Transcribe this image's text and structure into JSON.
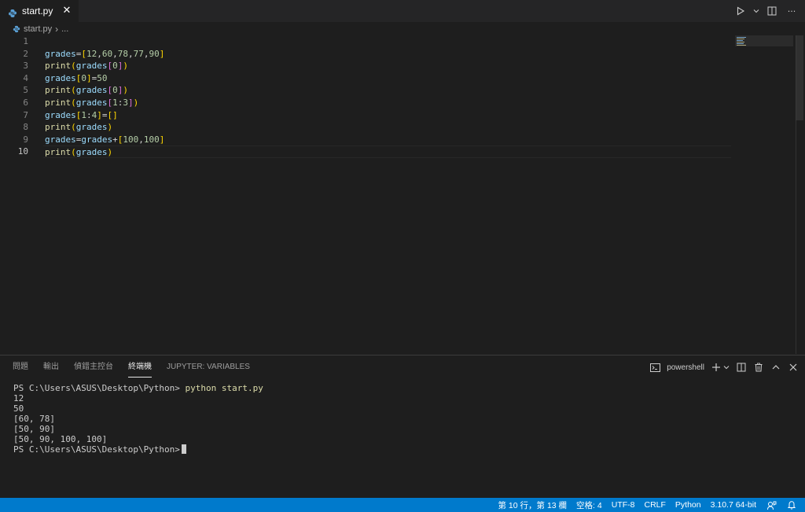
{
  "tabs": [
    {
      "label": "start.py",
      "close_glyph": "✕"
    }
  ],
  "toolbar": {
    "run_icon": "play-icon",
    "split_icon": "split-editor-icon",
    "more_glyph": "···"
  },
  "breadcrumb": {
    "file": "start.py",
    "separator": "›",
    "rest": "..."
  },
  "editor": {
    "line_numbers": [
      "1",
      "2",
      "3",
      "4",
      "5",
      "6",
      "7",
      "8",
      "9",
      "10"
    ],
    "current_line": 10
  },
  "panel": {
    "tabs": [
      "問題",
      "輸出",
      "偵錯主控台",
      "終端機",
      "JUPYTER: VARIABLES"
    ],
    "active_tab": "終端機",
    "shell_label": "powershell",
    "terminal": {
      "prompt": "PS C:\\Users\\ASUS\\Desktop\\Python>",
      "command": "python start.py",
      "output": [
        "12",
        "50",
        "[60, 78]",
        "[50, 90]",
        "[50, 90, 100, 100]"
      ]
    }
  },
  "statusbar": {
    "position": "第 10 行，第 13 欄",
    "spaces": "空格: 4",
    "encoding": "UTF-8",
    "eol": "CRLF",
    "language": "Python",
    "interpreter": "3.10.7 64-bit"
  },
  "colors": {
    "accent": "#007acc",
    "editor_bg": "#1e1e1e",
    "variable": "#9cdcfe",
    "function": "#dcdcaa",
    "number": "#b5cea8",
    "bracket_gold": "#ffd700",
    "bracket_pink": "#da70d6"
  }
}
